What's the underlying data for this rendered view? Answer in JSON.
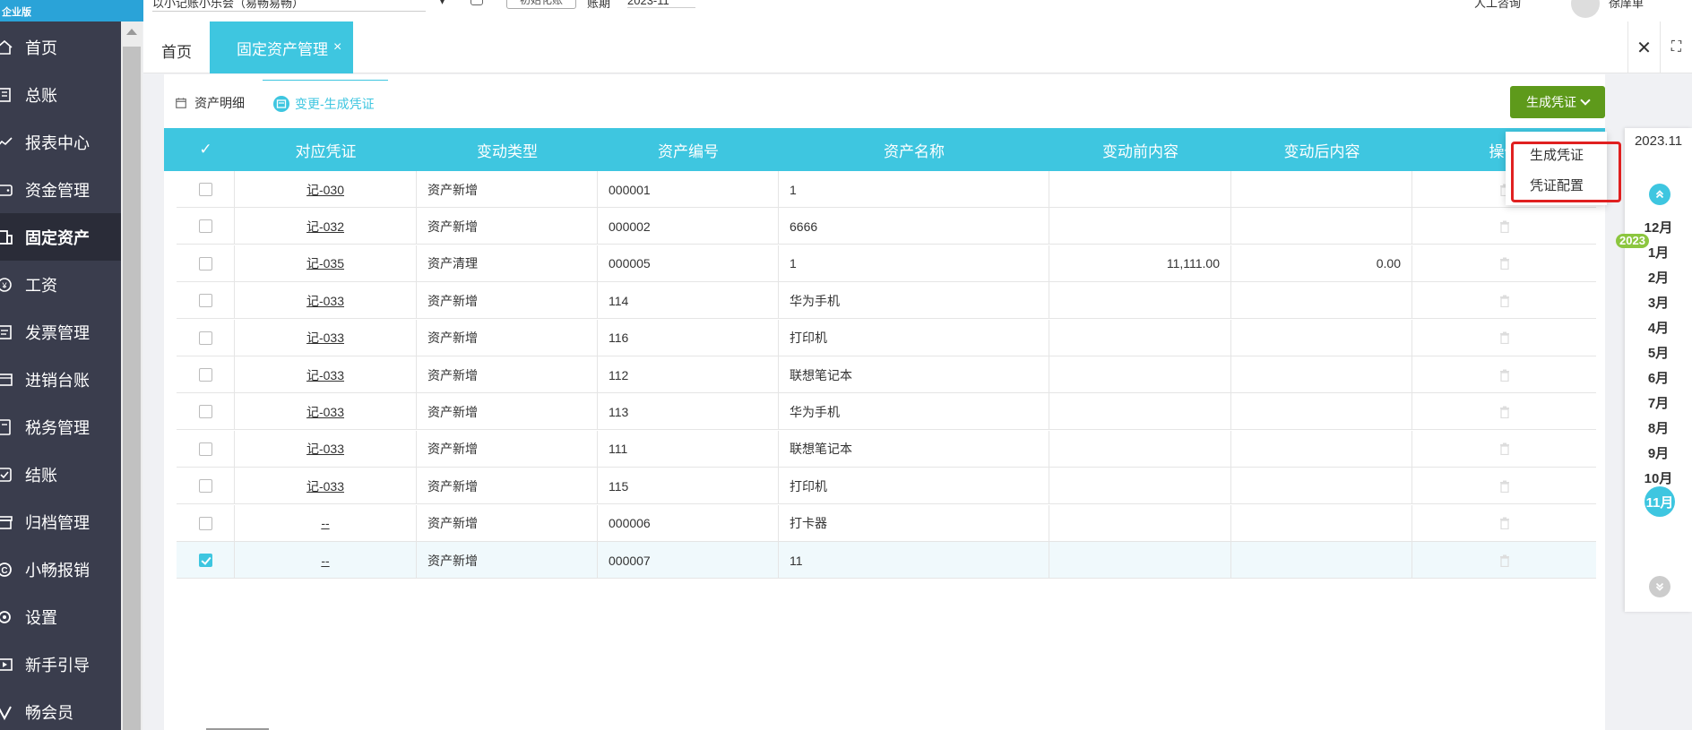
{
  "brand": "企业版",
  "sidebar": {
    "items": [
      {
        "label": "首页",
        "icon": "home-icon"
      },
      {
        "label": "总账",
        "icon": "ledger-icon"
      },
      {
        "label": "报表中心",
        "icon": "chart-icon"
      },
      {
        "label": "资金管理",
        "icon": "wallet-icon"
      },
      {
        "label": "固定资产",
        "icon": "building-icon"
      },
      {
        "label": "工资",
        "icon": "salary-icon"
      },
      {
        "label": "发票管理",
        "icon": "invoice-icon"
      },
      {
        "label": "进销台账",
        "icon": "inventory-icon"
      },
      {
        "label": "税务管理",
        "icon": "tax-icon"
      },
      {
        "label": "结账",
        "icon": "checkout-icon"
      },
      {
        "label": "归档管理",
        "icon": "archive-icon"
      },
      {
        "label": "小畅报销",
        "icon": "reimburse-icon"
      },
      {
        "label": "设置",
        "icon": "gear-icon"
      },
      {
        "label": "新手引导",
        "icon": "guide-icon"
      },
      {
        "label": "畅会员",
        "icon": "vip-icon"
      }
    ],
    "active_index": 4
  },
  "topbar": {
    "account_name": "以小记账小乐会（易畅易畅）",
    "init_button": "初始化账",
    "period_label": "账期",
    "period_value": "2023-11",
    "help": "人工咨询",
    "username": "徐庠单"
  },
  "tabs": {
    "home": "首页",
    "active": "固定资产管理",
    "close": "×"
  },
  "subtabs": [
    {
      "label": "资产明细"
    },
    {
      "label": "变更-生成凭证"
    }
  ],
  "generate_button": "生成凭证",
  "dropdown": {
    "options": [
      "生成凭证",
      "凭证配置"
    ]
  },
  "table": {
    "headers": [
      "✓",
      "对应凭证",
      "变动类型",
      "资产编号",
      "资产名称",
      "变动前内容",
      "变动后内容",
      "操作"
    ],
    "rows": [
      {
        "checked": false,
        "voucher": "记-030",
        "type": "资产新增",
        "code": "000001",
        "name": "1",
        "before": "",
        "after": ""
      },
      {
        "checked": false,
        "voucher": "记-032",
        "type": "资产新增",
        "code": "000002",
        "name": "6666",
        "before": "",
        "after": ""
      },
      {
        "checked": false,
        "voucher": "记-035",
        "type": "资产清理",
        "code": "000005",
        "name": "1",
        "before": "11,111.00",
        "after": "0.00"
      },
      {
        "checked": false,
        "voucher": "记-033",
        "type": "资产新增",
        "code": "114",
        "name": "华为手机",
        "before": "",
        "after": ""
      },
      {
        "checked": false,
        "voucher": "记-033",
        "type": "资产新增",
        "code": "116",
        "name": "打印机",
        "before": "",
        "after": ""
      },
      {
        "checked": false,
        "voucher": "记-033",
        "type": "资产新增",
        "code": "112",
        "name": "联想笔记本",
        "before": "",
        "after": ""
      },
      {
        "checked": false,
        "voucher": "记-033",
        "type": "资产新增",
        "code": "113",
        "name": "华为手机",
        "before": "",
        "after": ""
      },
      {
        "checked": false,
        "voucher": "记-033",
        "type": "资产新增",
        "code": "111",
        "name": "联想笔记本",
        "before": "",
        "after": ""
      },
      {
        "checked": false,
        "voucher": "记-033",
        "type": "资产新增",
        "code": "115",
        "name": "打印机",
        "before": "",
        "after": ""
      },
      {
        "checked": false,
        "voucher": "--",
        "type": "资产新增",
        "code": "000006",
        "name": "打卡器",
        "before": "",
        "after": ""
      },
      {
        "checked": true,
        "voucher": "--",
        "type": "资产新增",
        "code": "000007",
        "name": "11",
        "before": "",
        "after": ""
      }
    ]
  },
  "month_picker": {
    "period": "2023.11",
    "year_badge": "2023",
    "months": [
      "12月",
      "1月",
      "2月",
      "3月",
      "4月",
      "5月",
      "6月",
      "7月",
      "8月",
      "9月",
      "10月",
      "11月"
    ],
    "current": "11月"
  },
  "colors": {
    "accent": "#3ec6e0",
    "sidebar": "#3a3d4d",
    "generate_button": "#5e9a1b",
    "highlight": "#e02020",
    "year_badge": "#8cc63f"
  }
}
